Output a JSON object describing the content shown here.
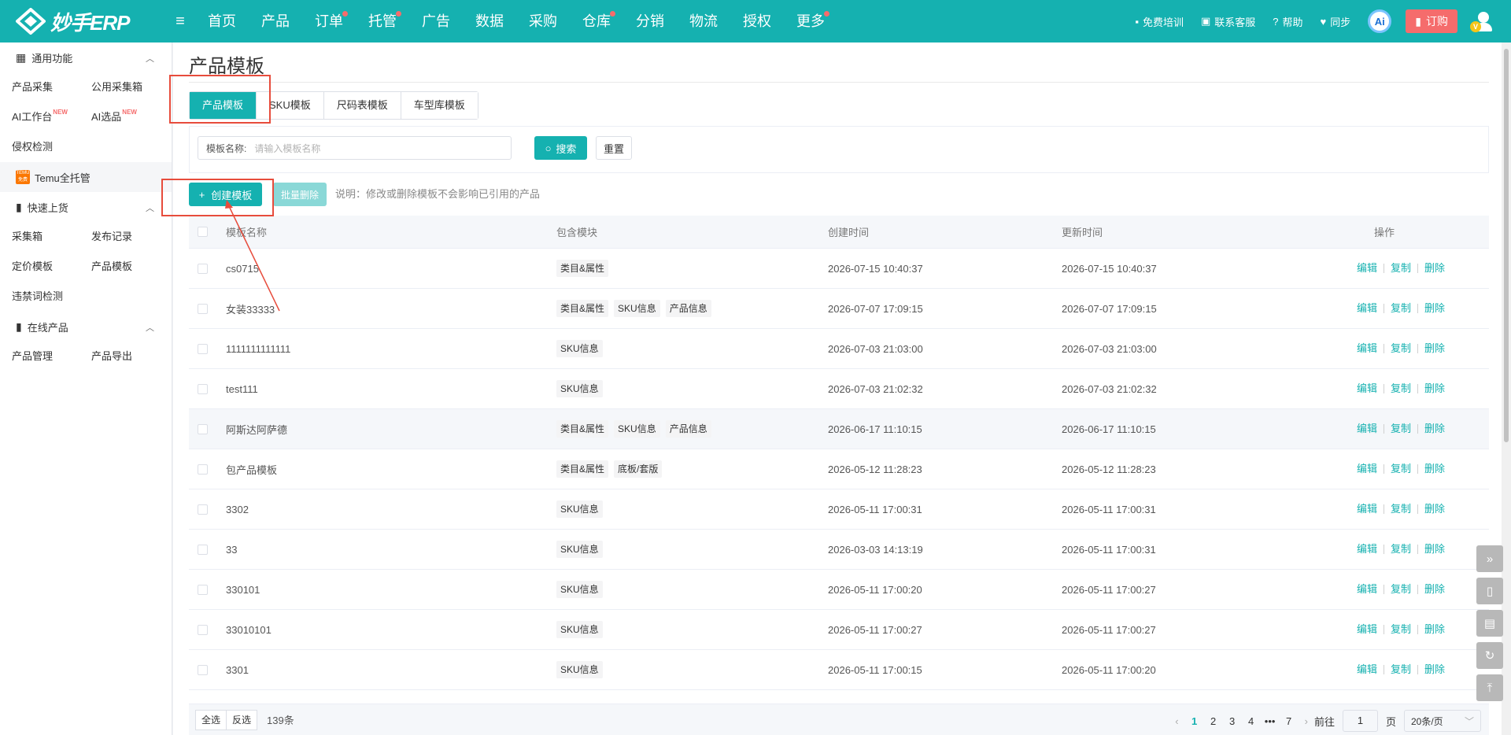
{
  "app": {
    "logo_text": "妙手ERP"
  },
  "nav": {
    "items": [
      {
        "label": "首页",
        "dot": false
      },
      {
        "label": "产品",
        "dot": false
      },
      {
        "label": "订单",
        "dot": true
      },
      {
        "label": "托管",
        "dot": true
      },
      {
        "label": "广告",
        "dot": false
      },
      {
        "label": "数据",
        "dot": false
      },
      {
        "label": "采购",
        "dot": false
      },
      {
        "label": "仓库",
        "dot": true
      },
      {
        "label": "分销",
        "dot": false
      },
      {
        "label": "物流",
        "dot": false
      },
      {
        "label": "授权",
        "dot": false
      },
      {
        "label": "更多",
        "dot": true
      }
    ]
  },
  "topright": {
    "training": "免费培训",
    "support": "联系客服",
    "help": "帮助",
    "sync": "同步",
    "ai": "Ai",
    "order": "订购",
    "vip": "V"
  },
  "sidebar": {
    "general": {
      "title": "通用功能",
      "items": [
        "产品采集",
        "公用采集箱",
        "AI工作台",
        "AI选品",
        "侵权检测"
      ],
      "new_badge": "NEW"
    },
    "temu": "Temu全托管",
    "temu_icon": "TEMU 免费",
    "quick": {
      "title": "快速上货",
      "items": [
        "采集箱",
        "发布记录",
        "定价模板",
        "产品模板",
        "违禁词检测"
      ]
    },
    "online": {
      "title": "在线产品",
      "items": [
        "产品管理",
        "产品导出"
      ]
    }
  },
  "page": {
    "title": "产品模板",
    "tabs": [
      "产品模板",
      "SKU模板",
      "尺码表模板",
      "车型库模板"
    ],
    "filter_label": "模板名称:",
    "filter_placeholder": "请输入模板名称",
    "search": "搜索",
    "reset": "重置",
    "create": "创建模板",
    "bulk_delete": "批量删除",
    "note": "说明：修改或删除模板不会影响已引用的产品"
  },
  "table": {
    "headers": [
      "模板名称",
      "包含模块",
      "创建时间",
      "更新时间",
      "操作"
    ],
    "rows": [
      {
        "name": "cs0715",
        "modules": [
          "类目&属性"
        ],
        "created": "2026-07-15 10:40:37",
        "updated": "2026-07-15 10:40:37"
      },
      {
        "name": "女装33333",
        "modules": [
          "类目&属性",
          "SKU信息",
          "产品信息"
        ],
        "created": "2026-07-07 17:09:15",
        "updated": "2026-07-07 17:09:15"
      },
      {
        "name": "1111111111111",
        "modules": [
          "SKU信息"
        ],
        "created": "2026-07-03 21:03:00",
        "updated": "2026-07-03 21:03:00"
      },
      {
        "name": "test111",
        "modules": [
          "SKU信息"
        ],
        "created": "2026-07-03 21:02:32",
        "updated": "2026-07-03 21:02:32"
      },
      {
        "name": "阿斯达阿萨德",
        "modules": [
          "类目&属性",
          "SKU信息",
          "产品信息"
        ],
        "created": "2026-06-17 11:10:15",
        "updated": "2026-06-17 11:10:15"
      },
      {
        "name": "包产品模板",
        "modules": [
          "类目&属性",
          "底板/套版"
        ],
        "created": "2026-05-12 11:28:23",
        "updated": "2026-05-12 11:28:23"
      },
      {
        "name": "3302",
        "modules": [
          "SKU信息"
        ],
        "created": "2026-05-11 17:00:31",
        "updated": "2026-05-11 17:00:31"
      },
      {
        "name": "33",
        "modules": [
          "SKU信息"
        ],
        "created": "2026-03-03 14:13:19",
        "updated": "2026-05-11 17:00:31"
      },
      {
        "name": "330101",
        "modules": [
          "SKU信息"
        ],
        "created": "2026-05-11 17:00:20",
        "updated": "2026-05-11 17:00:27"
      },
      {
        "name": "33010101",
        "modules": [
          "SKU信息"
        ],
        "created": "2026-05-11 17:00:27",
        "updated": "2026-05-11 17:00:27"
      },
      {
        "name": "3301",
        "modules": [
          "SKU信息"
        ],
        "created": "2026-05-11 17:00:15",
        "updated": "2026-05-11 17:00:20"
      }
    ],
    "ops": [
      "编辑",
      "复制",
      "删除"
    ]
  },
  "footer": {
    "select_all": "全选",
    "invert": "反选",
    "count": "139条",
    "pages": [
      "1",
      "2",
      "3",
      "4",
      "•••",
      "7"
    ],
    "goto": "前往",
    "goto_value": "1",
    "page_unit": "页",
    "page_size": "20条/页"
  },
  "colors": {
    "accent": "#15b1b0",
    "highlight_box": "#e74c3c",
    "dot": "#f56c6c"
  }
}
